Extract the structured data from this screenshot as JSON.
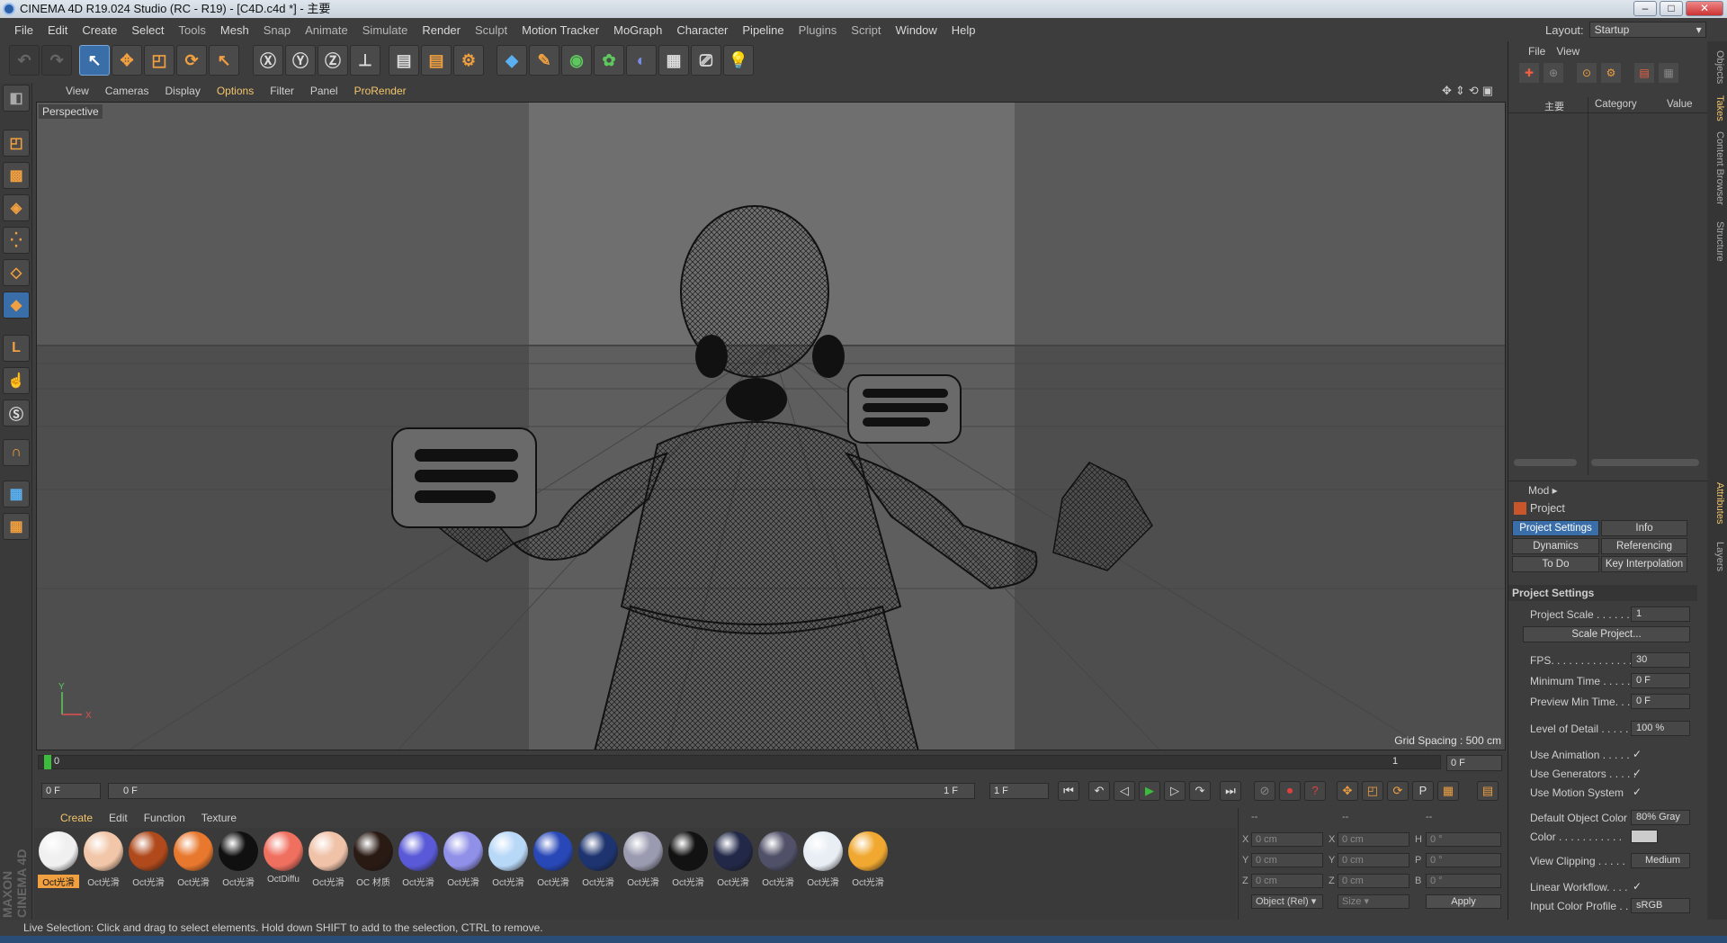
{
  "window": {
    "title": "CINEMA 4D R19.024 Studio (RC - R19) - [C4D.c4d *] - 主要"
  },
  "menu": [
    "File",
    "Edit",
    "Create",
    "Select",
    "Tools",
    "Mesh",
    "Snap",
    "Animate",
    "Simulate",
    "Render",
    "Sculpt",
    "Motion Tracker",
    "MoGraph",
    "Character",
    "Pipeline",
    "Plugins",
    "Script",
    "Window",
    "Help"
  ],
  "layout": {
    "label": "Layout:",
    "value": "Startup"
  },
  "viewport_menu": [
    "View",
    "Cameras",
    "Display",
    "Options",
    "Filter",
    "Panel",
    "ProRender"
  ],
  "viewport": {
    "name": "Perspective",
    "grid_spacing": "Grid Spacing : 500 cm"
  },
  "timeline": {
    "start": "0",
    "end_marker": "1",
    "frame_field": "0 F"
  },
  "transport": {
    "current": "0 F",
    "range_start": "0 F",
    "range_end": "1 F",
    "end_field": "1 F"
  },
  "material_menu": [
    "Create",
    "Edit",
    "Function",
    "Texture"
  ],
  "materials": [
    {
      "label": "Oct光滑",
      "color": "#f0f0f0"
    },
    {
      "label": "Oct光滑",
      "color": "#f2c6a8"
    },
    {
      "label": "Oct光滑",
      "color": "#b04a1c"
    },
    {
      "label": "Oct光滑",
      "color": "#e8782e"
    },
    {
      "label": "Oct光滑",
      "color": "#101010"
    },
    {
      "label": "OctDiffu",
      "color": "#f07060"
    },
    {
      "label": "Oct光滑",
      "color": "#f0c2a8"
    },
    {
      "label": "OC 材质",
      "color": "#2a1a14"
    },
    {
      "label": "Oct光滑",
      "color": "#5a5ad8"
    },
    {
      "label": "Oct光滑",
      "color": "#9090e8"
    },
    {
      "label": "Oct光滑",
      "color": "#b8d8f8"
    },
    {
      "label": "Oct光滑",
      "color": "#2848b8"
    },
    {
      "label": "Oct光滑",
      "color": "#1e3470"
    },
    {
      "label": "Oct光滑",
      "color": "#9a9ab0"
    },
    {
      "label": "Oct光滑",
      "color": "#121212"
    },
    {
      "label": "Oct光滑",
      "color": "#222848"
    },
    {
      "label": "Oct光滑",
      "color": "#505068"
    },
    {
      "label": "Oct光滑",
      "color": "#e8eef4"
    },
    {
      "label": "Oct光滑",
      "color": "#f0a830"
    }
  ],
  "coords": {
    "header": [
      "--",
      "--",
      "--"
    ],
    "rows": [
      {
        "a": "X",
        "av": "0 cm",
        "b": "X",
        "bv": "0 cm",
        "c": "H",
        "cv": "0 °"
      },
      {
        "a": "Y",
        "av": "0 cm",
        "b": "Y",
        "bv": "0 cm",
        "c": "P",
        "cv": "0 °"
      },
      {
        "a": "Z",
        "av": "0 cm",
        "b": "Z",
        "bv": "0 cm",
        "c": "B",
        "cv": "0 °"
      }
    ],
    "mode": "Object (Rel)",
    "size": "Size",
    "apply": "Apply"
  },
  "objects_panel": {
    "menu": [
      "File",
      "View"
    ],
    "col_name": "主要",
    "col_category": "Category",
    "col_value": "Value"
  },
  "attributes": {
    "mode": "Mod",
    "title": "Project",
    "tabs": [
      [
        "Project Settings",
        "Info"
      ],
      [
        "Dynamics",
        "Referencing"
      ],
      [
        "To Do",
        "Key Interpolation"
      ]
    ],
    "section": "Project Settings",
    "scale_label": "Project Scale . . . . . . .",
    "scale_value": "1",
    "scale_button": "Scale Project...",
    "fps_label": "FPS. . . . . . . . . . . . . . .",
    "fps_value": "30",
    "min_time_label": "Minimum Time . . . . .",
    "min_time_value": "0 F",
    "preview_min_label": "Preview Min Time. . .",
    "preview_min_value": "0 F",
    "lod_label": "Level of Detail . . . . . .",
    "lod_value": "100 %",
    "use_anim_label": "Use Animation . . . . .",
    "use_gen_label": "Use Generators . . . . .",
    "use_motion_label": "Use Motion System",
    "def_color_label": "Default Object Color",
    "def_color_value": "80% Gray",
    "color_label": "Color . . . . . . . . . . .",
    "clipping_label": "View Clipping . . . . .",
    "clipping_value": "Medium",
    "linear_label": "Linear Workflow. . . .",
    "profile_label": "Input Color Profile . .",
    "profile_value": "sRGB",
    "check": "✓"
  },
  "right_tabs": [
    "Objects",
    "Takes",
    "Content Browser",
    "Structure",
    "Attributes",
    "Layers"
  ],
  "status": "Live Selection: Click and drag to select elements. Hold down SHIFT to add to the selection, CTRL to remove.",
  "brand": "MAXON CINEMA 4D"
}
